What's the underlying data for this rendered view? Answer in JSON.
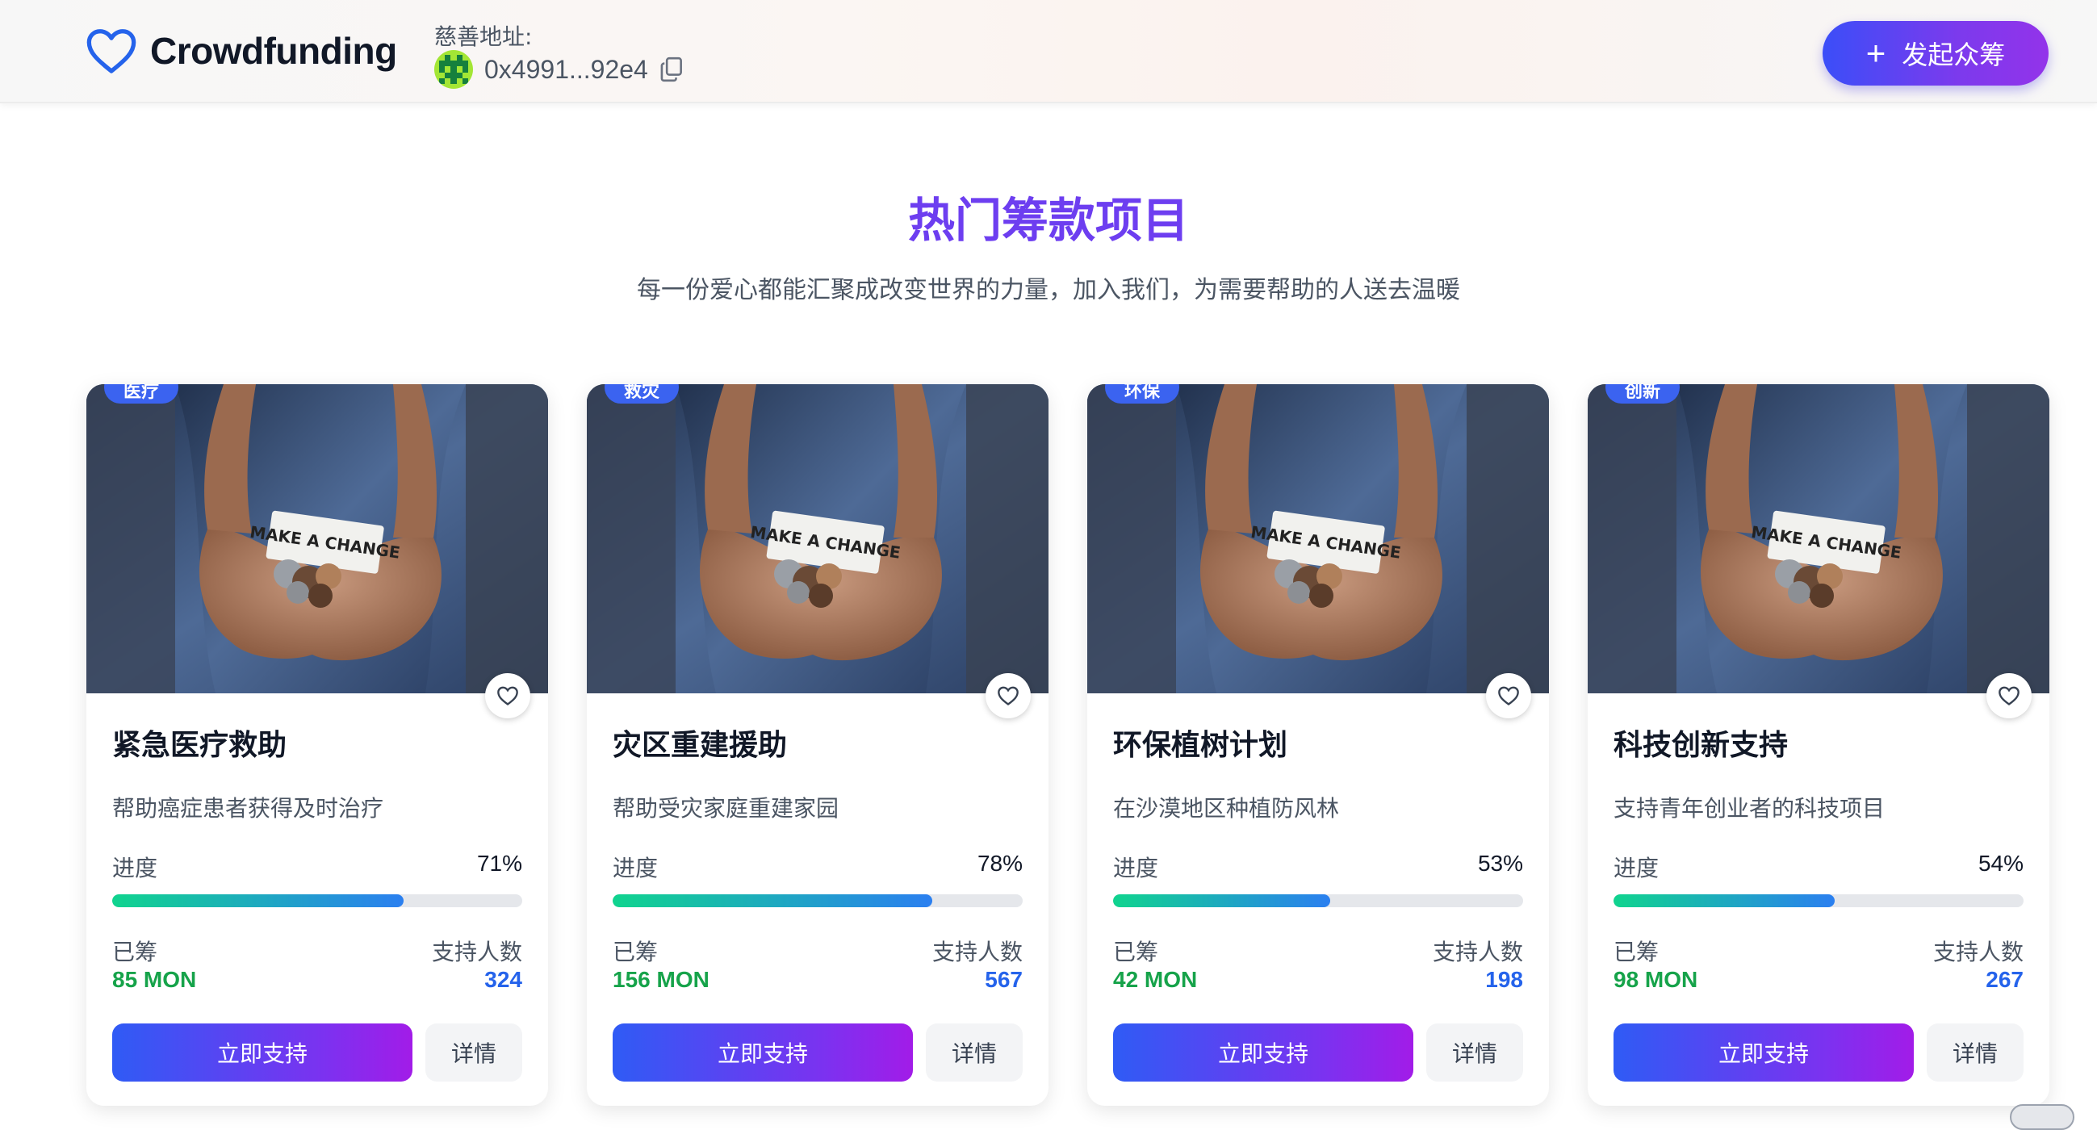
{
  "header": {
    "brand": "Crowdfunding",
    "address_label": "慈善地址:",
    "address": "0x4991...92e4",
    "start_button": "发起众筹",
    "start_icon": "+"
  },
  "section": {
    "title": "热门筹款项目",
    "subtitle": "每一份爱心都能汇聚成改变世界的力量，加入我们，为需要帮助的人送去温暖"
  },
  "labels": {
    "progress": "进度",
    "raised": "已筹",
    "backers": "支持人数",
    "support": "立即支持",
    "details": "详情"
  },
  "projects": [
    {
      "tag": "医疗",
      "title": "紧急医疗救助",
      "desc": "帮助癌症患者获得及时治疗",
      "progress": 71,
      "progress_text": "71%",
      "raised": "85 MON",
      "backers": "324"
    },
    {
      "tag": "救灾",
      "title": "灾区重建援助",
      "desc": "帮助受灾家庭重建家园",
      "progress": 78,
      "progress_text": "78%",
      "raised": "156 MON",
      "backers": "567"
    },
    {
      "tag": "环保",
      "title": "环保植树计划",
      "desc": "在沙漠地区种植防风林",
      "progress": 53,
      "progress_text": "53%",
      "raised": "42 MON",
      "backers": "198"
    },
    {
      "tag": "创新",
      "title": "科技创新支持",
      "desc": "支持青年创业者的科技项目",
      "progress": 54,
      "progress_text": "54%",
      "raised": "98 MON",
      "backers": "267"
    }
  ],
  "image_text": "MAKE A CHANGE",
  "colors": {
    "brand_gradient_start": "#3b4ef8",
    "brand_gradient_end": "#9333ea",
    "title_purple": "#6d3ef0",
    "raised_green": "#16a34a",
    "backers_blue": "#2563eb",
    "tag_blue": "#3b63f0"
  }
}
